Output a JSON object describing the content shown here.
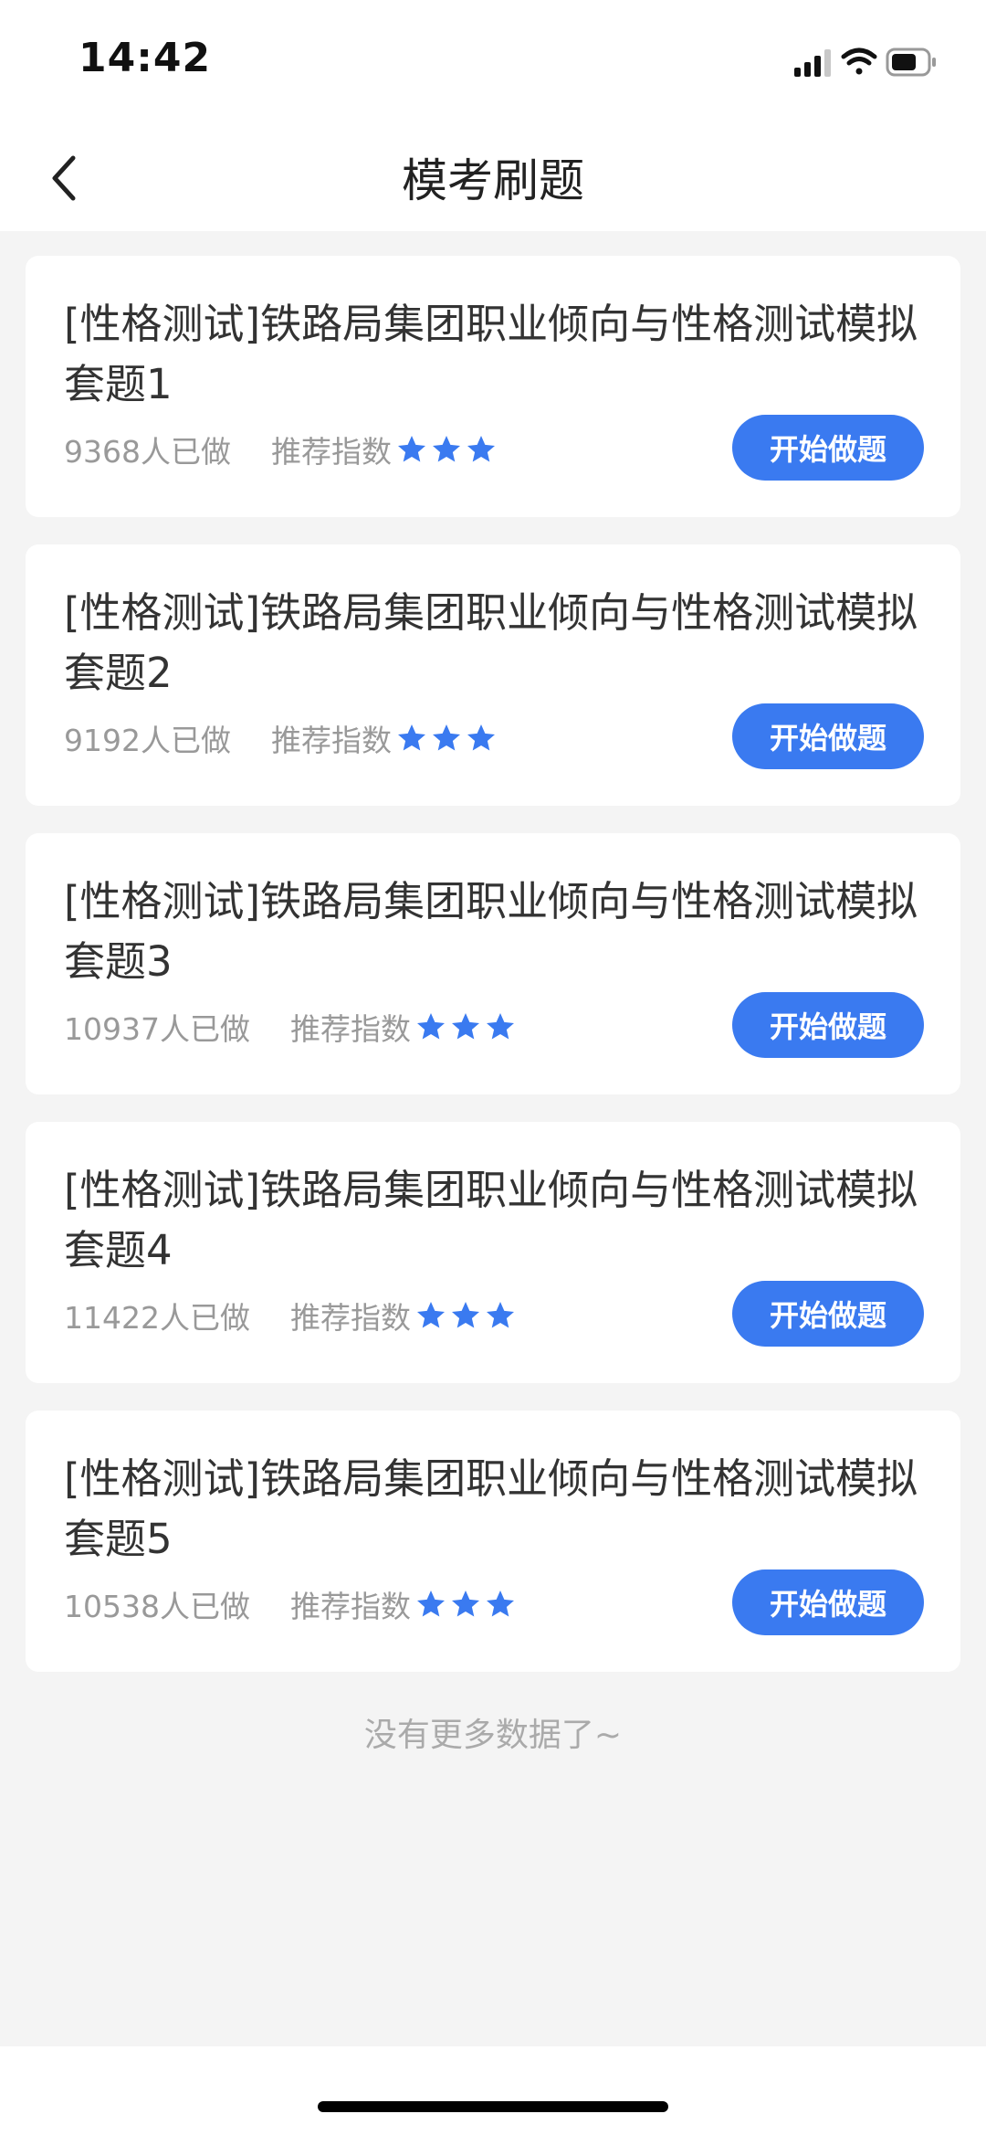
{
  "status": {
    "time": "14:42"
  },
  "nav": {
    "title": "模考刷题"
  },
  "items": [
    {
      "title": "[性格测试]铁路局集团职业倾向与性格测试模拟套题1",
      "count": "9368人已做",
      "recommend_label": "推荐指数",
      "stars": 3,
      "button": "开始做题"
    },
    {
      "title": "[性格测试]铁路局集团职业倾向与性格测试模拟套题2",
      "count": "9192人已做",
      "recommend_label": "推荐指数",
      "stars": 3,
      "button": "开始做题"
    },
    {
      "title": "[性格测试]铁路局集团职业倾向与性格测试模拟套题3",
      "count": "10937人已做",
      "recommend_label": "推荐指数",
      "stars": 3,
      "button": "开始做题"
    },
    {
      "title": "[性格测试]铁路局集团职业倾向与性格测试模拟套题4",
      "count": "11422人已做",
      "recommend_label": "推荐指数",
      "stars": 3,
      "button": "开始做题"
    },
    {
      "title": "[性格测试]铁路局集团职业倾向与性格测试模拟套题5",
      "count": "10538人已做",
      "recommend_label": "推荐指数",
      "stars": 3,
      "button": "开始做题"
    }
  ],
  "footer": {
    "no_more": "没有更多数据了~"
  },
  "colors": {
    "accent": "#3a7af0",
    "star": "#3a7af0",
    "background": "#f4f4f4"
  },
  "icons": {
    "back": "chevron-left-icon",
    "signal": "signal-icon",
    "wifi": "wifi-icon",
    "battery": "battery-icon",
    "star": "star-icon"
  }
}
